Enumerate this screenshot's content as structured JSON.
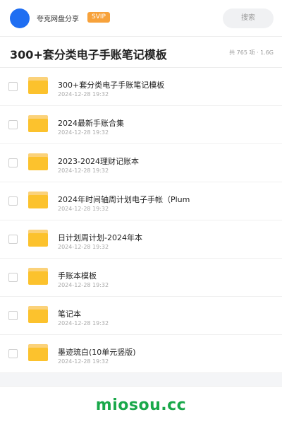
{
  "header": {
    "app_name": "夸克网盘分享",
    "badge": "SVIP",
    "search_label": "搜索"
  },
  "titlebar": {
    "title": "300+套分类电子手账笔记模板",
    "meta": "共 765 项 · 1.6G"
  },
  "items": [
    {
      "name": "300+套分类电子手账笔记模板",
      "date": "2024-12-28 19:32"
    },
    {
      "name": "2024最新手账合集",
      "date": "2024-12-28 19:32"
    },
    {
      "name": "2023-2024理财记账本",
      "date": "2024-12-28 19:32"
    },
    {
      "name": "2024年时间轴周计划电子手帐（Plum",
      "date": "2024-12-28 19:32"
    },
    {
      "name": "日计划周计划-2024年本",
      "date": "2024-12-28 19:32"
    },
    {
      "name": "手账本模板",
      "date": "2024-12-28 19:32"
    },
    {
      "name": "笔记本",
      "date": "2024-12-28 19:32"
    },
    {
      "name": "墨迹琉白(10单元竖版)",
      "date": "2024-12-28 19:32"
    }
  ],
  "footer": {
    "watermark": "miosou.cc"
  },
  "colors": {
    "avatar": "#1f6ef2",
    "badge": "#f7a23b",
    "folder": "#fcc22d",
    "watermark": "#19a84a"
  }
}
